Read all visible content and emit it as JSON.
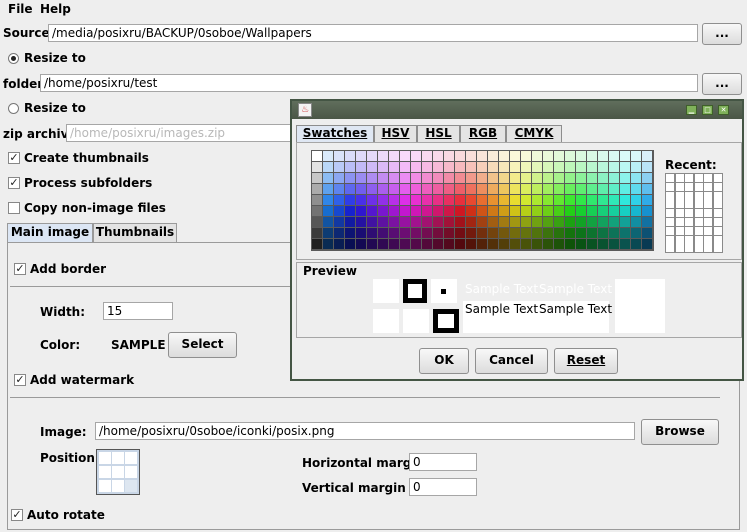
{
  "menu": {
    "file": "File",
    "help": "Help"
  },
  "source": {
    "label": "Source:",
    "value": "/media/posixru/BACKUP/0soboe/Wallpapers",
    "browse": "..."
  },
  "resize_folder": {
    "label": "Resize to",
    "selected": true,
    "folder_label": "folder:",
    "folder_value": "/home/posixru/test",
    "browse": "..."
  },
  "resize_zip": {
    "label": "Resize to",
    "selected": false,
    "zip_label": "zip archive:",
    "zip_value": "/home/posixru/images.zip"
  },
  "options": {
    "create_thumbnails": {
      "label": "Create thumbnails",
      "checked": true
    },
    "process_subfolders": {
      "label": "Process subfolders",
      "checked": true
    },
    "copy_non_image": {
      "label": "Copy non-image files",
      "checked": false
    }
  },
  "tabs": [
    {
      "label": "Main image",
      "active": true
    },
    {
      "label": "Thumbnails",
      "active": false
    }
  ],
  "border": {
    "add_border": {
      "label": "Add border",
      "checked": true
    },
    "width_label": "Width:",
    "width_value": "15",
    "color_label": "Color:",
    "color_sample": "SAMPLE",
    "select_button": "Select"
  },
  "watermark": {
    "add_watermark": {
      "label": "Add watermark",
      "checked": true
    },
    "image_label": "Image:",
    "image_value": "/home/posixru/0soboe/iconki/posix.png",
    "browse_button": "Browse",
    "position_label": "Position:",
    "horizontal_margin_label": "Horizontal margin",
    "horizontal_margin_value": "0",
    "vertical_margin_label": "Vertical margin",
    "vertical_margin_value": "0"
  },
  "auto_rotate": {
    "label": "Auto rotate",
    "checked": true
  },
  "color_dialog": {
    "tabs": [
      {
        "label": "Swatches",
        "active": true
      },
      {
        "label": "HSV",
        "active": false
      },
      {
        "label": "HSL",
        "active": false
      },
      {
        "label": "RGB",
        "active": false
      },
      {
        "label": "CMYK",
        "active": false
      }
    ],
    "recent_label": "Recent:",
    "preview_label": "Preview",
    "sample_text": "Sample Text",
    "buttons": {
      "ok": "OK",
      "cancel": "Cancel",
      "reset": "Reset"
    },
    "title_icon": "java-icon",
    "window_controls": [
      "minimize-icon",
      "maximize-icon",
      "close-icon"
    ]
  }
}
